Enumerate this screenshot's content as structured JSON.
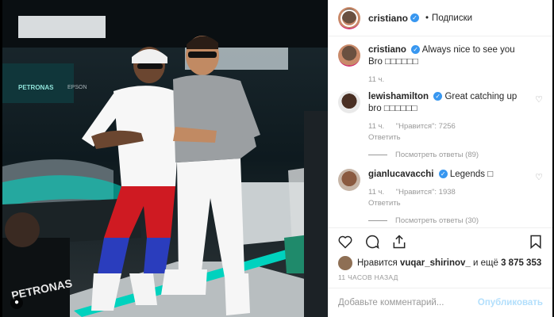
{
  "post": {
    "header": {
      "username": "cristiano",
      "follow_label": "Подписки",
      "dot": "•"
    },
    "caption": {
      "username": "cristiano",
      "text": "Always nice to see you Bro □□□□□□",
      "time": "11 ч."
    },
    "comments": [
      {
        "username": "lewishamilton",
        "text": "Great catching up bro □□□□□□",
        "time": "11 ч.",
        "likes": "\"Нравится\": 7256",
        "reply": "Ответить",
        "view_replies": "Посмотреть ответы (89)"
      },
      {
        "username": "gianlucavacchi",
        "text": "Legends □",
        "time": "11 ч.",
        "likes": "\"Нравится\": 1938",
        "reply": "Ответить",
        "view_replies": "Посмотреть ответы (30)"
      }
    ],
    "likes_line": {
      "prefix": "Нравится",
      "user": "vuqar_shirinov_",
      "suffix": "и ещё",
      "count": "3 875 353"
    },
    "time_ago": "11 ЧАСОВ НАЗАД",
    "add_comment_placeholder": "Добавьте комментарий...",
    "publish_label": "Опубликовать"
  },
  "photo": {
    "car_brand": "PETRONAS",
    "sponsor": "EPSON",
    "shirt": "PETRONAS"
  },
  "colors": {
    "accent": "#3897f0",
    "teal": "#00d2be"
  },
  "icons": [
    "heart-icon",
    "comment-icon",
    "share-icon",
    "bookmark-icon",
    "more-icon",
    "verified-icon",
    "user-icon"
  ]
}
